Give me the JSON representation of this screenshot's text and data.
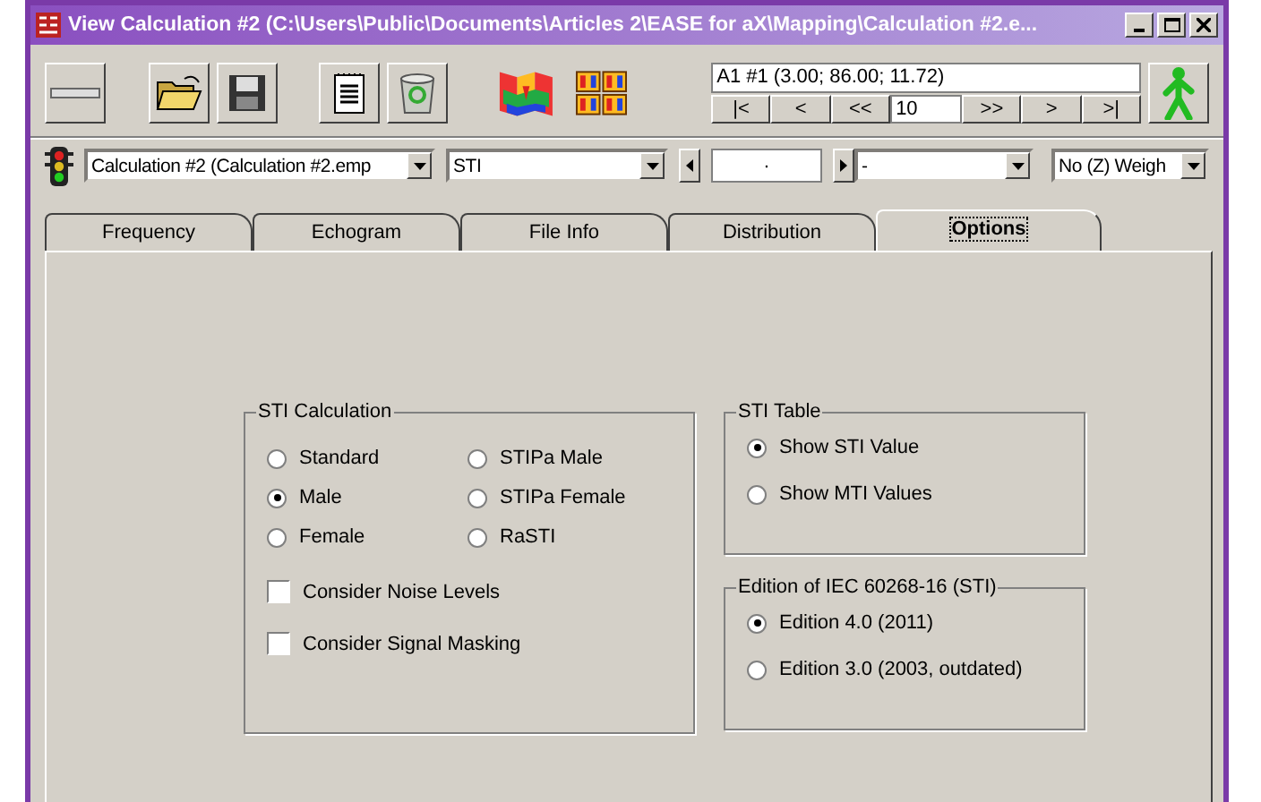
{
  "window": {
    "title": "View Calculation #2 (C:\\Users\\Public\\Documents\\Articles 2\\EASE for aX\\Mapping\\Calculation #2.e..."
  },
  "position": {
    "label": "A1 #1  (3.00; 86.00; 11.72)",
    "step": "10",
    "nav": [
      "|<",
      "<",
      "<<",
      ">>",
      ">",
      ">|"
    ]
  },
  "selectors": {
    "calculation": "Calculation #2 (Calculation #2.emp",
    "parameter": "STI",
    "stepper_value": "·",
    "band": "-",
    "weighting": "No (Z) Weigh"
  },
  "tabs": [
    {
      "label": "Frequency",
      "selected": false
    },
    {
      "label": "Echogram",
      "selected": false
    },
    {
      "label": "File Info",
      "selected": false
    },
    {
      "label": "Distribution",
      "selected": false
    },
    {
      "label": "Options",
      "selected": true
    }
  ],
  "sti_calculation": {
    "title": "STI Calculation",
    "options": [
      {
        "label": "Standard",
        "selected": false
      },
      {
        "label": "STIPa Male",
        "selected": false
      },
      {
        "label": "Male",
        "selected": true
      },
      {
        "label": "STIPa Female",
        "selected": false
      },
      {
        "label": "Female",
        "selected": false
      },
      {
        "label": "RaSTI",
        "selected": false
      }
    ],
    "checks": [
      {
        "label": "Consider Noise Levels",
        "checked": false
      },
      {
        "label": "Consider Signal Masking",
        "checked": false
      }
    ]
  },
  "sti_table": {
    "title": "STI Table",
    "options": [
      {
        "label": "Show STI Value",
        "selected": true
      },
      {
        "label": "Show MTI Values",
        "selected": false
      }
    ]
  },
  "edition": {
    "title": "Edition of IEC 60268-16 (STI)",
    "options": [
      {
        "label": "Edition 4.0 (2011)",
        "selected": true
      },
      {
        "label": "Edition 3.0 (2003, outdated)",
        "selected": false
      }
    ]
  }
}
